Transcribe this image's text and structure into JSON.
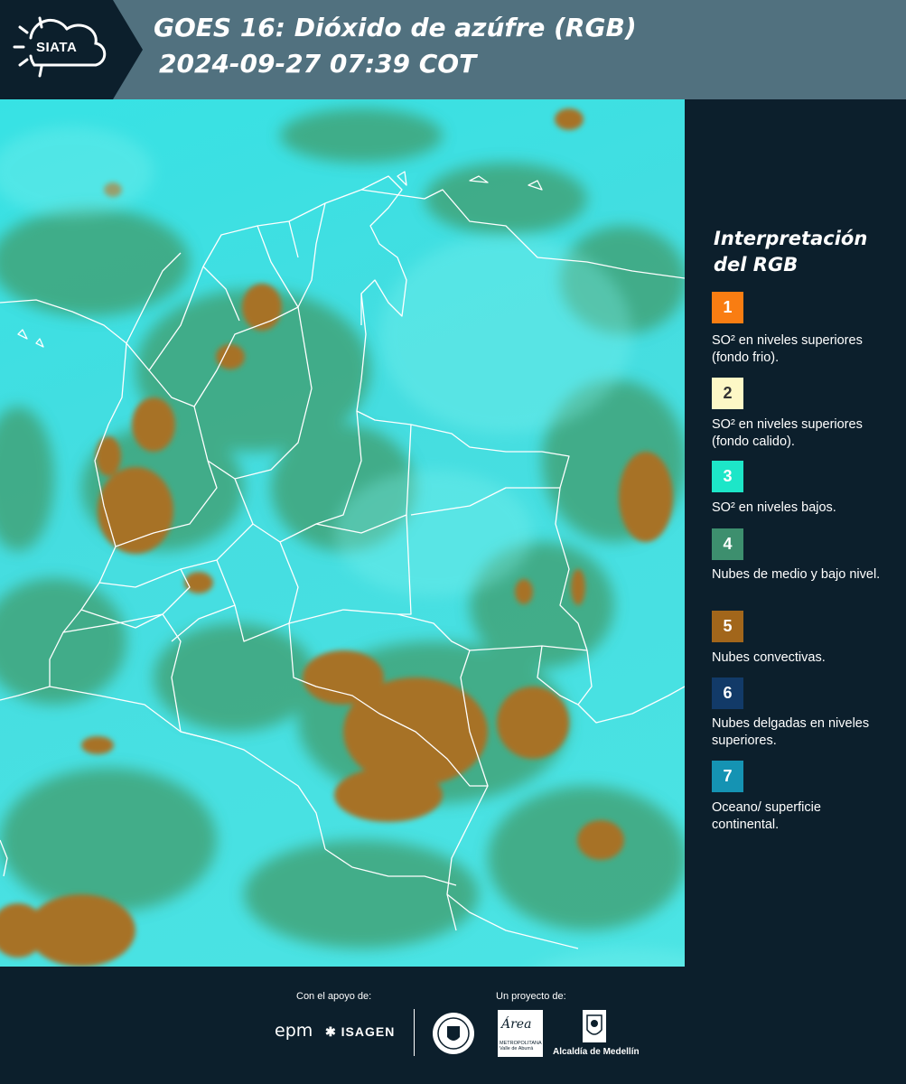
{
  "header": {
    "logo_text": "SIATA",
    "title_line1": "GOES 16: Dióxido de azúfre (RGB)",
    "title_line2": "2024-09-27 07:39 COT"
  },
  "legend": {
    "title": "Interpretación del RGB",
    "items": [
      {
        "number": "1",
        "color": "#f97d12",
        "text_color": "#ffffff",
        "label": "SO² en niveles superiores (fondo frio)."
      },
      {
        "number": "2",
        "color": "#fdf8c6",
        "text_color": "#333333",
        "label": "SO² en niveles superiores (fondo calido)."
      },
      {
        "number": "3",
        "color": "#1de6c8",
        "text_color": "#ffffff",
        "label": "SO² en niveles bajos."
      },
      {
        "number": "4",
        "color": "#3d8f6e",
        "text_color": "#ffffff",
        "label": "Nubes de medio y bajo nivel."
      },
      {
        "number": "5",
        "color": "#a2661b",
        "text_color": "#ffffff",
        "label": "Nubes convectivas."
      },
      {
        "number": "6",
        "color": "#123a68",
        "text_color": "#ffffff",
        "label": "Nubes delgadas en niveles superiores."
      },
      {
        "number": "7",
        "color": "#1593b3",
        "text_color": "#ffffff",
        "label": "Oceano/ superficie continental."
      }
    ]
  },
  "footer": {
    "support_label": "Con el apoyo de:",
    "project_label": "Un proyecto de:",
    "epm": "epm",
    "isagen": "ISAGEN",
    "area_logo": "Área",
    "area_sub": "METROPOLITANA Valle de Aburrá",
    "alcaldia": "Alcaldía de Medellín"
  },
  "colors": {
    "panel": "#0c1f2c",
    "header": "#51717f",
    "map_cyan": "#40e0e0",
    "cloud_green": "#3f9c6c",
    "convective_brown": "#a77226"
  }
}
